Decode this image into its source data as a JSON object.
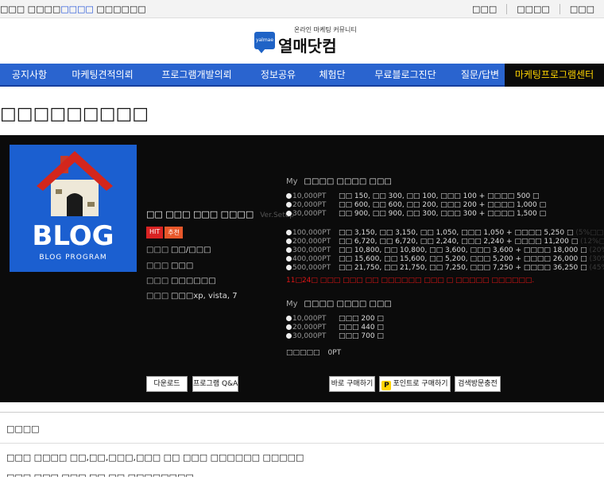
{
  "topbar": {
    "welcome_prefix": "□□□ □□□□",
    "welcome_highlight": "□□□□",
    "welcome_suffix": "□□□□□□",
    "links": [
      "□□□",
      "□□□□",
      "□□□"
    ]
  },
  "logo": {
    "badge": "yalmae",
    "tagline": "온라인 마케팅 커뮤니티",
    "name": "열매닷컴"
  },
  "nav": [
    "공지사항",
    "마케팅견적의뢰",
    "프로그램개발의뢰",
    "정보공유",
    "체험단",
    "무료블로그진단",
    "질문/답변",
    "마케팅프로그램센터"
  ],
  "page_title": "□□□□□□□□□",
  "product": {
    "thumb_title": "BLOG",
    "thumb_sub": "BLOG PROGRAM",
    "name": "□□ □□□ □□□ □□□□",
    "version": "Ver.Setup",
    "tag_hit": "HIT",
    "tag_rec": "추천",
    "specs": [
      {
        "k": "□□□",
        "v": "□□/□□□"
      },
      {
        "k": "□□□",
        "v": "□□□"
      },
      {
        "k": "□□□",
        "v": "□□□□□□"
      },
      {
        "k": "□□□",
        "v": "□□□xp, vista, 7"
      }
    ],
    "buttons": {
      "download": "다운로드",
      "qa": "프로그램 Q&A",
      "buy_now": "바로 구매하기",
      "buy_point": "포인트로 구매하기",
      "charge": "검색방문충전"
    }
  },
  "pricing": {
    "section1_my": "My",
    "section1_title": "□□□□ □□□□ □□□",
    "group1": [
      {
        "pt": "10,000PT",
        "d": "□□ 150, □□ 300, □□ 100, □□□ 100 + □□□□ 500 □",
        "pct": ""
      },
      {
        "pt": "20,000PT",
        "d": "□□ 600, □□ 600, □□ 200, □□□ 200 + □□□□ 1,000 □",
        "pct": ""
      },
      {
        "pt": "30,000PT",
        "d": "□□ 900, □□ 900, □□ 300, □□□ 300 + □□□□ 1,500 □",
        "pct": ""
      }
    ],
    "group2": [
      {
        "pt": "100,000PT",
        "d": "□□ 3,150, □□ 3,150, □□ 1,050, □□□ 1,050 + □□□□ 5,250 □",
        "pct": "(5%□□)"
      },
      {
        "pt": "200,000PT",
        "d": "□□ 6,720, □□ 6,720, □□ 2,240, □□□ 2,240 + □□□□ 11,200 □",
        "pct": "(12%□□)"
      },
      {
        "pt": "300,000PT",
        "d": "□□ 10,800, □□ 10,800, □□ 3,600, □□□ 3,600 + □□□□ 18,000 □",
        "pct": "(20%□□)"
      },
      {
        "pt": "400,000PT",
        "d": "□□ 15,600, □□ 15,600, □□ 5,200, □□□ 5,200 + □□□□ 26,000 □",
        "pct": "(30%□□)"
      },
      {
        "pt": "500,000PT",
        "d": "□□ 21,750, □□ 21,750, □□ 7,250, □□□ 7,250 + □□□□ 36,250 □",
        "pct": "(45%□□)"
      }
    ],
    "notice": "11□24□ □□□ □□□ □□ □□□□□□ □□□ □ □□□□□ □□□□□□.",
    "section2_my": "My",
    "section2_title": "□□□□ □□□□ □□□",
    "group3": [
      {
        "pt": "10,000PT",
        "d": "□□□ 200 □"
      },
      {
        "pt": "20,000PT",
        "d": "□□□ 440 □"
      },
      {
        "pt": "30,000PT",
        "d": "□□□ 700 □"
      }
    ],
    "current_label": "□□□□□",
    "current_value": "0PT"
  },
  "footer": {
    "heading": "□□□□",
    "line1": "□□□ □□□□ □□,□□,□□□,□□□ □□ □□□ □□□□□□ □□□□□",
    "line2": "□□□ □□□ □□□ □□ □□ □□□□□□□□"
  }
}
